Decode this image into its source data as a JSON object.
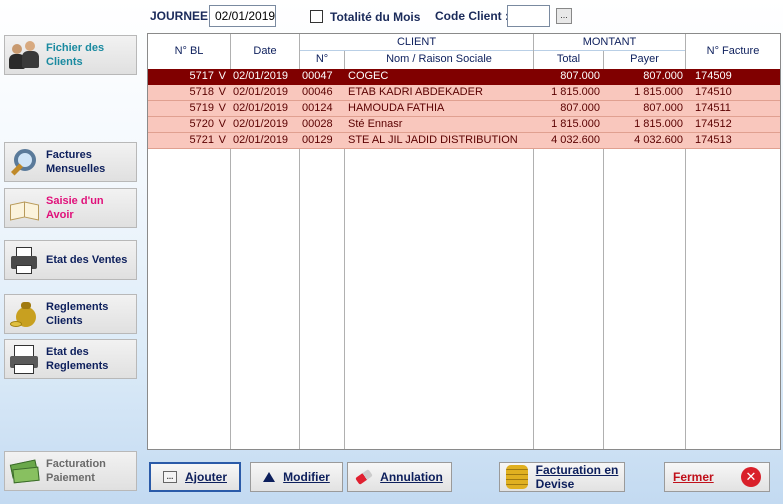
{
  "filters": {
    "journee_label": "JOURNEE :",
    "journee_value": "02/01/2019",
    "totalite_label": "Totalité du Mois",
    "code_client_label": "Code Client :",
    "code_client_value": "",
    "browse_label": "..."
  },
  "sidebar": {
    "fichier_clients": "Fichier des Clients",
    "factures_mensuelles": "Factures Mensuelles",
    "saisie_avoir": "Saisie d'un Avoir",
    "etat_ventes": "Etat des Ventes",
    "reglements_clients": "Reglements Clients",
    "etat_reglements": "Etat des Reglements",
    "facturation_paiement": "Facturation Paiement"
  },
  "table": {
    "headers": {
      "bl": "N° BL",
      "date": "Date",
      "client_group": "CLIENT",
      "client_no": "N°",
      "client_name": "Nom / Raison Sociale",
      "montant_group": "MONTANT",
      "total": "Total",
      "payer": "Payer",
      "facture": "N° Facture"
    },
    "rows": [
      {
        "bl": "5717",
        "flag": "V",
        "date": "02/01/2019",
        "client_no": "00047",
        "name": "COGEC",
        "total": "807.000",
        "payer": "807.000",
        "facture": "174509"
      },
      {
        "bl": "5718",
        "flag": "V",
        "date": "02/01/2019",
        "client_no": "00046",
        "name": "ETAB KADRI ABDEKADER",
        "total": "1 815.000",
        "payer": "1 815.000",
        "facture": "174510"
      },
      {
        "bl": "5719",
        "flag": "V",
        "date": "02/01/2019",
        "client_no": "00124",
        "name": "HAMOUDA FATHIA",
        "total": "807.000",
        "payer": "807.000",
        "facture": "174511"
      },
      {
        "bl": "5720",
        "flag": "V",
        "date": "02/01/2019",
        "client_no": "00028",
        "name": "Sté Ennasr",
        "total": "1 815.000",
        "payer": "1 815.000",
        "facture": "174512"
      },
      {
        "bl": "5721",
        "flag": "V",
        "date": "02/01/2019",
        "client_no": "00129",
        "name": "STE AL JIL  JADID DISTRIBUTION",
        "total": "4 032.600",
        "payer": "4 032.600",
        "facture": "174513"
      }
    ]
  },
  "actions": {
    "ajouter": "Ajouter",
    "modifier": "Modifier",
    "annulation": "Annulation",
    "facturation_devise_1": "Facturation en",
    "facturation_devise_2": "Devise",
    "fermer": "Fermer"
  },
  "colors": {
    "selected_row": "#800000",
    "row_bg": "#f9c7bd",
    "label_blue": "#0d1f5c"
  }
}
